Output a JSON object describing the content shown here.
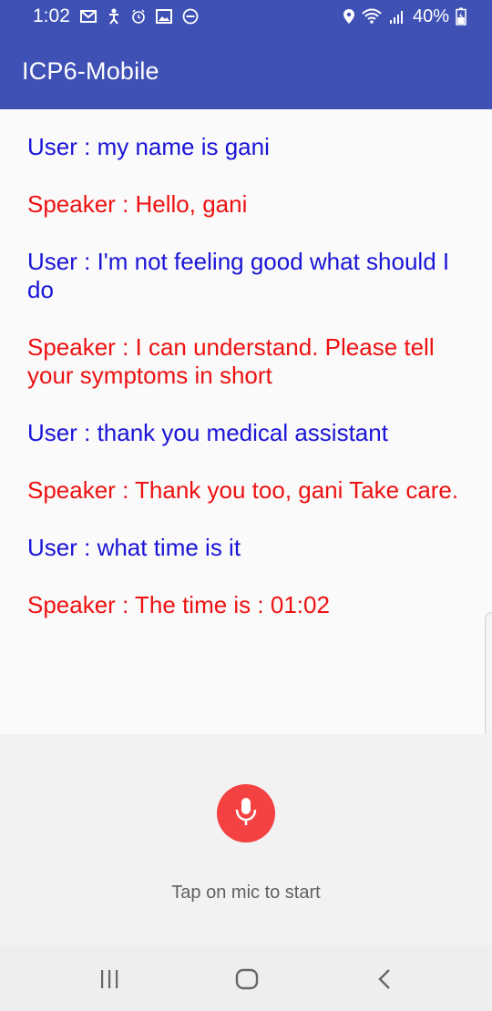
{
  "status_bar": {
    "time": "1:02",
    "battery": "40%",
    "icons_left": [
      "gmail-icon",
      "accessibility-icon",
      "alarm-icon",
      "image-icon",
      "do-not-disturb-icon"
    ],
    "icons_right": [
      "location-icon",
      "wifi-icon",
      "signal-icon",
      "battery-icon"
    ]
  },
  "app_bar": {
    "title": "ICP6-Mobile"
  },
  "conversation": {
    "messages": [
      {
        "role": "user",
        "text": "User : my name is gani"
      },
      {
        "role": "speaker",
        "text": "Speaker : Hello, gani"
      },
      {
        "role": "user",
        "text": "User : I'm not feeling good what should I do"
      },
      {
        "role": "speaker",
        "text": "Speaker : I can understand. Please tell your symptoms in short"
      },
      {
        "role": "user",
        "text": "User : thank you medical assistant"
      },
      {
        "role": "speaker",
        "text": "Speaker : Thank you too, gani Take care."
      },
      {
        "role": "user",
        "text": "User : what time is it"
      },
      {
        "role": "speaker",
        "text": "Speaker : The time is : 01:02"
      }
    ]
  },
  "mic": {
    "hint": "Tap on mic to start",
    "icon": "microphone-icon"
  },
  "nav_bar": {
    "icons": [
      "recent-apps-icon",
      "home-icon",
      "back-icon"
    ]
  },
  "colors": {
    "primary": "#3f51b5",
    "user_text": "#1a14d6",
    "speaker_text": "#ee1111",
    "mic_button": "#f44242"
  }
}
